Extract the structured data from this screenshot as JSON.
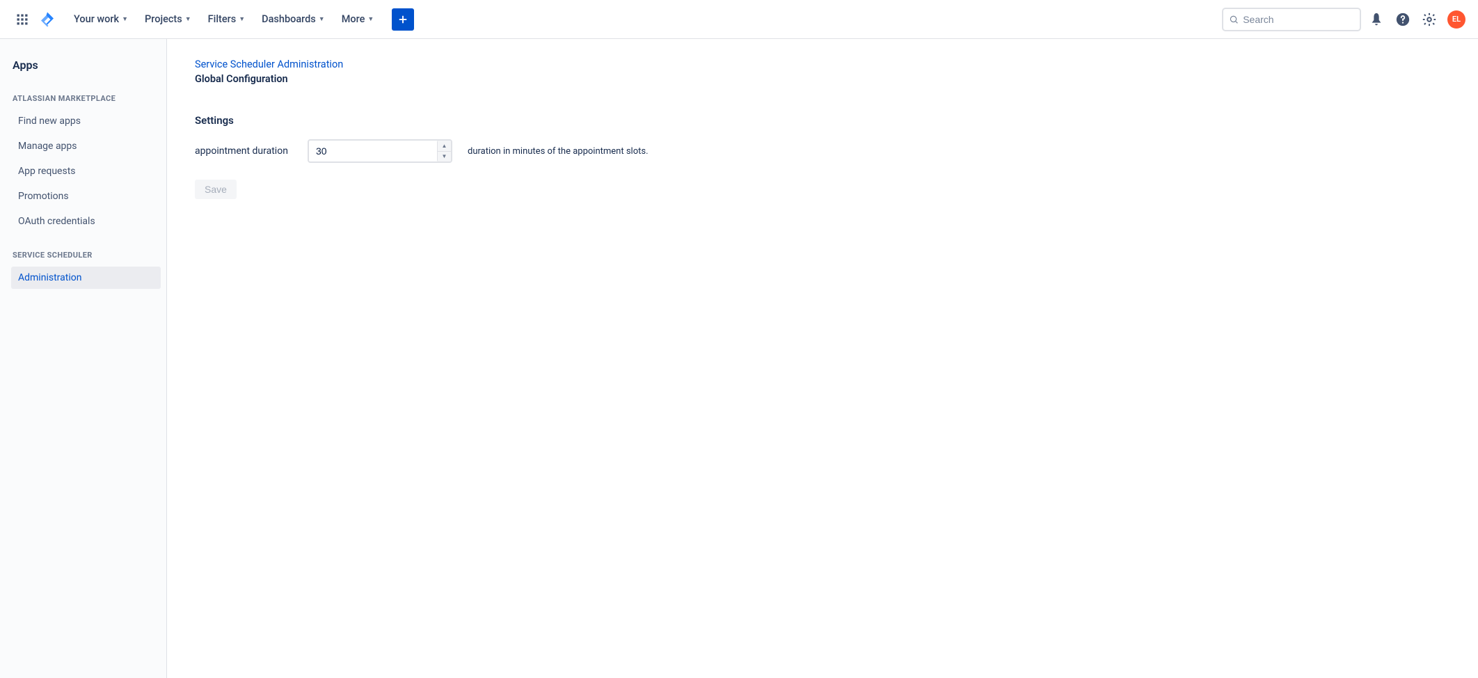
{
  "header": {
    "nav": [
      "Your work",
      "Projects",
      "Filters",
      "Dashboards",
      "More"
    ],
    "search_placeholder": "Search",
    "avatar_initials": "EL"
  },
  "sidebar": {
    "title": "Apps",
    "sections": [
      {
        "header": "ATLASSIAN MARKETPLACE",
        "items": [
          {
            "label": "Find new apps",
            "selected": false
          },
          {
            "label": "Manage apps",
            "selected": false
          },
          {
            "label": "App requests",
            "selected": false
          },
          {
            "label": "Promotions",
            "selected": false
          },
          {
            "label": "OAuth credentials",
            "selected": false
          }
        ]
      },
      {
        "header": "SERVICE SCHEDULER",
        "items": [
          {
            "label": "Administration",
            "selected": true
          }
        ]
      }
    ]
  },
  "main": {
    "breadcrumb": "Service Scheduler Administration",
    "title": "Global Configuration",
    "settings_heading": "Settings",
    "field": {
      "label": "appointment duration",
      "value": "30",
      "help": "duration in minutes of the appointment slots."
    },
    "save_label": "Save"
  }
}
